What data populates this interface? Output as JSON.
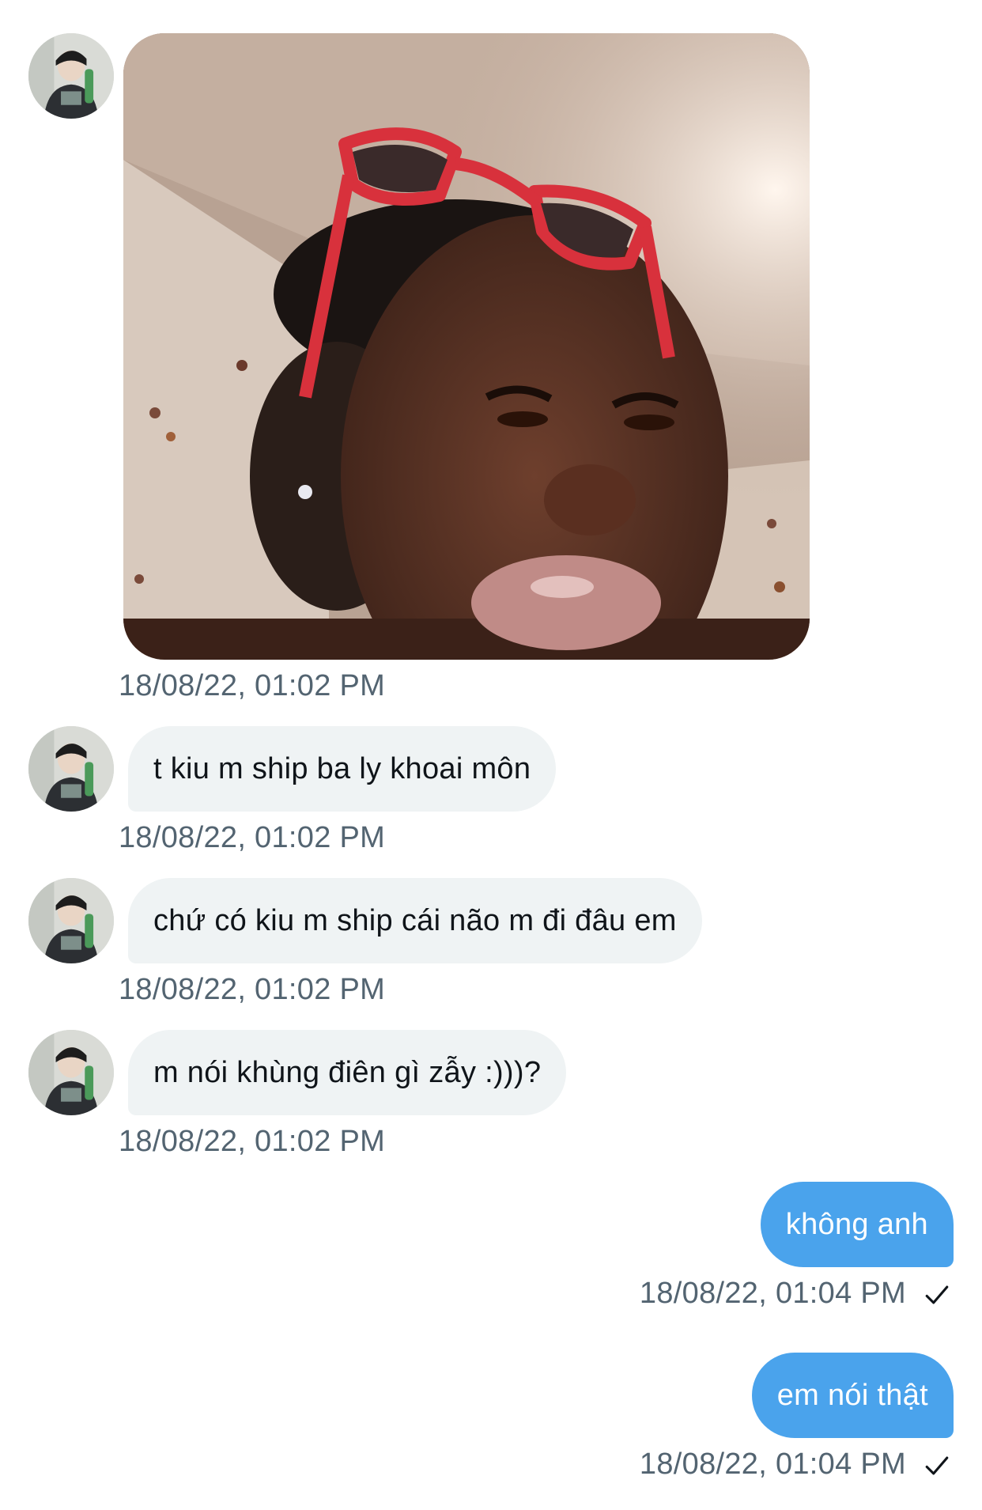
{
  "conversation": {
    "incoming": [
      {
        "type": "image",
        "timestamp": "18/08/22, 01:02 PM"
      },
      {
        "type": "text",
        "text": "t kiu m ship ba ly khoai môn",
        "timestamp": "18/08/22, 01:02 PM"
      },
      {
        "type": "text",
        "text": "chứ có kiu m ship cái não m đi đâu em",
        "timestamp": "18/08/22, 01:02 PM"
      },
      {
        "type": "text",
        "text": "m nói khùng điên gì zẫy :)))?",
        "timestamp": "18/08/22, 01:02 PM"
      }
    ],
    "outgoing": [
      {
        "text": "không anh",
        "timestamp": "18/08/22, 01:04 PM",
        "status_icon": "check-icon"
      },
      {
        "text": "em nói thật",
        "timestamp": "18/08/22, 01:04 PM",
        "status_icon": "check-icon"
      }
    ]
  },
  "colors": {
    "incoming_bubble": "#eff3f4",
    "outgoing_bubble": "#4aa3ec",
    "timestamp_text": "#536471",
    "message_text": "#0f1419"
  }
}
